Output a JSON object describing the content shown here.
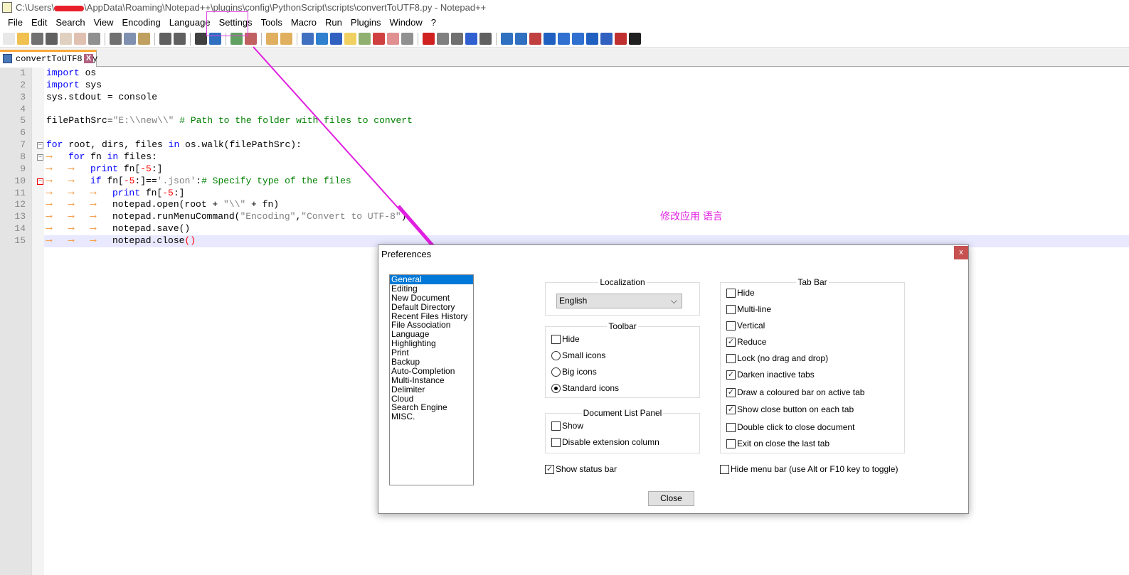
{
  "window": {
    "title_prefix": "C:\\Users\\",
    "title_suffix": "\\AppData\\Roaming\\Notepad++\\plugins\\config\\PythonScript\\scripts\\convertToUTF8.py - Notepad++"
  },
  "menu": [
    "File",
    "Edit",
    "Search",
    "View",
    "Encoding",
    "Language",
    "Settings",
    "Tools",
    "Macro",
    "Run",
    "Plugins",
    "Window",
    "?"
  ],
  "toolbar": {
    "icons": [
      {
        "name": "new-file-icon",
        "color": "#e8e8e8"
      },
      {
        "name": "open-file-icon",
        "color": "#f0c050"
      },
      {
        "name": "save-icon",
        "color": "#707070"
      },
      {
        "name": "save-all-icon",
        "color": "#606060"
      },
      {
        "name": "close-icon",
        "color": "#e0d0c0"
      },
      {
        "name": "close-all-icon",
        "color": "#e0c0b0"
      },
      {
        "name": "print-icon",
        "color": "#909090"
      },
      {
        "sep": true
      },
      {
        "name": "cut-icon",
        "color": "#707070"
      },
      {
        "name": "copy-icon",
        "color": "#8090b0"
      },
      {
        "name": "paste-icon",
        "color": "#c0a060"
      },
      {
        "sep": true
      },
      {
        "name": "undo-icon",
        "color": "#606060"
      },
      {
        "name": "redo-icon",
        "color": "#606060"
      },
      {
        "sep": true
      },
      {
        "name": "find-icon",
        "color": "#404040"
      },
      {
        "name": "replace-icon",
        "color": "#3070c0"
      },
      {
        "sep": true
      },
      {
        "name": "zoom-in-icon",
        "color": "#60a060"
      },
      {
        "name": "zoom-out-icon",
        "color": "#c06060"
      },
      {
        "sep": true
      },
      {
        "name": "sync-vertical-icon",
        "color": "#e0b060"
      },
      {
        "name": "sync-horizontal-icon",
        "color": "#e0b060"
      },
      {
        "sep": true
      },
      {
        "name": "word-wrap-icon",
        "color": "#4070c0"
      },
      {
        "name": "show-all-chars-icon",
        "color": "#3080d0"
      },
      {
        "name": "indent-guide-icon",
        "color": "#3060c0"
      },
      {
        "name": "udl-icon",
        "color": "#f0d060"
      },
      {
        "name": "doc-map-icon",
        "color": "#90b070"
      },
      {
        "name": "function-list-icon",
        "color": "#d04040"
      },
      {
        "name": "folder-workspace-icon",
        "color": "#e09090"
      },
      {
        "name": "monitoring-icon",
        "color": "#909090"
      },
      {
        "sep": true
      },
      {
        "name": "record-macro-icon",
        "color": "#d02020"
      },
      {
        "name": "stop-record-icon",
        "color": "#808080"
      },
      {
        "name": "play-macro-icon",
        "color": "#707070"
      },
      {
        "name": "play-multiple-icon",
        "color": "#3060d0"
      },
      {
        "name": "save-macro-icon",
        "color": "#606060"
      },
      {
        "sep": true
      },
      {
        "name": "plugin-1-icon",
        "color": "#3070c0"
      },
      {
        "name": "plugin-2-icon",
        "color": "#3070c0"
      },
      {
        "name": "plugin-3-icon",
        "color": "#c04040"
      },
      {
        "name": "plugin-4-icon",
        "color": "#2060c0"
      },
      {
        "name": "up-icon",
        "color": "#3070d0"
      },
      {
        "name": "down-icon",
        "color": "#3070d0"
      },
      {
        "name": "plugin-7-icon",
        "color": "#2060c0"
      },
      {
        "name": "plugin-8-icon",
        "color": "#3060c0"
      },
      {
        "name": "spellcheck-icon",
        "color": "#c03030"
      },
      {
        "name": "markdown-icon",
        "color": "#202020"
      }
    ]
  },
  "tab": {
    "label": "convertToUTF8.py",
    "close": "X"
  },
  "editor": {
    "lines": [
      {
        "n": "1",
        "indent": 0,
        "tokens": [
          {
            "t": "import",
            "c": "kw"
          },
          {
            "t": " os",
            "c": "op"
          }
        ]
      },
      {
        "n": "2",
        "indent": 0,
        "tokens": [
          {
            "t": "import",
            "c": "kw"
          },
          {
            "t": " sys",
            "c": "op"
          }
        ]
      },
      {
        "n": "3",
        "indent": 0,
        "tokens": [
          {
            "t": "sys.stdout = console",
            "c": "op"
          }
        ]
      },
      {
        "n": "4",
        "indent": 0,
        "tokens": []
      },
      {
        "n": "5",
        "indent": 0,
        "tokens": [
          {
            "t": "filePathSrc=",
            "c": "op"
          },
          {
            "t": "\"E:\\\\new\\\\\"",
            "c": "str"
          },
          {
            "t": " # Path to the folder with files to convert",
            "c": "com"
          }
        ]
      },
      {
        "n": "6",
        "indent": 0,
        "tokens": []
      },
      {
        "n": "7",
        "indent": 0,
        "fold": "−",
        "tokens": [
          {
            "t": "for",
            "c": "kw"
          },
          {
            "t": " root, dirs, files ",
            "c": "op"
          },
          {
            "t": "in",
            "c": "kw"
          },
          {
            "t": " os.walk(filePathSrc):",
            "c": "op"
          }
        ]
      },
      {
        "n": "8",
        "indent": 1,
        "fold": "−",
        "tokens": [
          {
            "t": "for",
            "c": "kw"
          },
          {
            "t": " fn ",
            "c": "op"
          },
          {
            "t": "in",
            "c": "kw"
          },
          {
            "t": " files:",
            "c": "op"
          }
        ]
      },
      {
        "n": "9",
        "indent": 2,
        "tokens": [
          {
            "t": "print",
            "c": "kw"
          },
          {
            "t": " fn[",
            "c": "op"
          },
          {
            "t": "-5",
            "c": "num"
          },
          {
            "t": ":]",
            "c": "op"
          }
        ]
      },
      {
        "n": "10",
        "indent": 2,
        "fold": "−",
        "tokens": [
          {
            "t": "if",
            "c": "kw"
          },
          {
            "t": " fn[",
            "c": "op"
          },
          {
            "t": "-5",
            "c": "num"
          },
          {
            "t": ":]==",
            "c": "op"
          },
          {
            "t": "'.json'",
            "c": "str"
          },
          {
            "t": ":",
            "c": "op"
          },
          {
            "t": "# Specify type of the files",
            "c": "com"
          }
        ]
      },
      {
        "n": "11",
        "indent": 3,
        "tokens": [
          {
            "t": "print",
            "c": "kw"
          },
          {
            "t": " fn[",
            "c": "op"
          },
          {
            "t": "-5",
            "c": "num"
          },
          {
            "t": ":]",
            "c": "op"
          }
        ]
      },
      {
        "n": "12",
        "indent": 3,
        "tokens": [
          {
            "t": "notepad.open(root + ",
            "c": "op"
          },
          {
            "t": "\"\\\\\"",
            "c": "str"
          },
          {
            "t": " + fn)",
            "c": "op"
          }
        ]
      },
      {
        "n": "13",
        "indent": 3,
        "tokens": [
          {
            "t": "notepad.runMenuCommand(",
            "c": "op"
          },
          {
            "t": "\"Encoding\"",
            "c": "str"
          },
          {
            "t": ",",
            "c": "op"
          },
          {
            "t": "\"Convert to UTF-8\"",
            "c": "str"
          },
          {
            "t": ")",
            "c": "op"
          }
        ]
      },
      {
        "n": "14",
        "indent": 3,
        "tokens": [
          {
            "t": "notepad.save()",
            "c": "op"
          }
        ]
      },
      {
        "n": "15",
        "indent": 3,
        "current": true,
        "tokens": [
          {
            "t": "notepad.close",
            "c": "op"
          },
          {
            "t": "()",
            "c": "br"
          }
        ]
      }
    ]
  },
  "annotation": {
    "text": "修改应用 语言",
    "color": "#e020e0"
  },
  "dialog": {
    "title": "Preferences",
    "close_x": "x",
    "categories": [
      "General",
      "Editing",
      "New Document",
      "Default Directory",
      "Recent Files History",
      "File Association",
      "Language",
      "Highlighting",
      "Print",
      "Backup",
      "Auto-Completion",
      "Multi-Instance",
      "Delimiter",
      "Cloud",
      "Search Engine",
      "MISC."
    ],
    "selected_category": "General",
    "localization": {
      "title": "Localization",
      "value": "English"
    },
    "toolbar_group": {
      "title": "Toolbar",
      "hide": {
        "label": "Hide",
        "checked": false
      },
      "radios": [
        {
          "label": "Small icons",
          "checked": false
        },
        {
          "label": "Big icons",
          "checked": false
        },
        {
          "label": "Standard icons",
          "checked": true
        }
      ]
    },
    "doc_list": {
      "title": "Document List Panel",
      "options": [
        {
          "label": "Show",
          "checked": false
        },
        {
          "label": "Disable extension column",
          "checked": false
        }
      ]
    },
    "show_status_bar": {
      "label": "Show status bar",
      "checked": true
    },
    "tab_bar": {
      "title": "Tab Bar",
      "options": [
        {
          "label": "Hide",
          "checked": false
        },
        {
          "label": "Multi-line",
          "checked": false
        },
        {
          "label": "Vertical",
          "checked": false
        },
        {
          "label": "Reduce",
          "checked": true
        },
        {
          "label": "Lock (no drag and drop)",
          "checked": false
        },
        {
          "label": "Darken inactive tabs",
          "checked": true
        },
        {
          "label": "Draw a coloured bar on active tab",
          "checked": true
        },
        {
          "label": "Show close button on each tab",
          "checked": true
        },
        {
          "label": "Double click to close document",
          "checked": false
        },
        {
          "label": "Exit on close the last tab",
          "checked": false
        }
      ]
    },
    "hide_menu_bar": {
      "label": "Hide menu bar (use Alt or F10 key to toggle)",
      "checked": false
    },
    "close_button": "Close"
  }
}
